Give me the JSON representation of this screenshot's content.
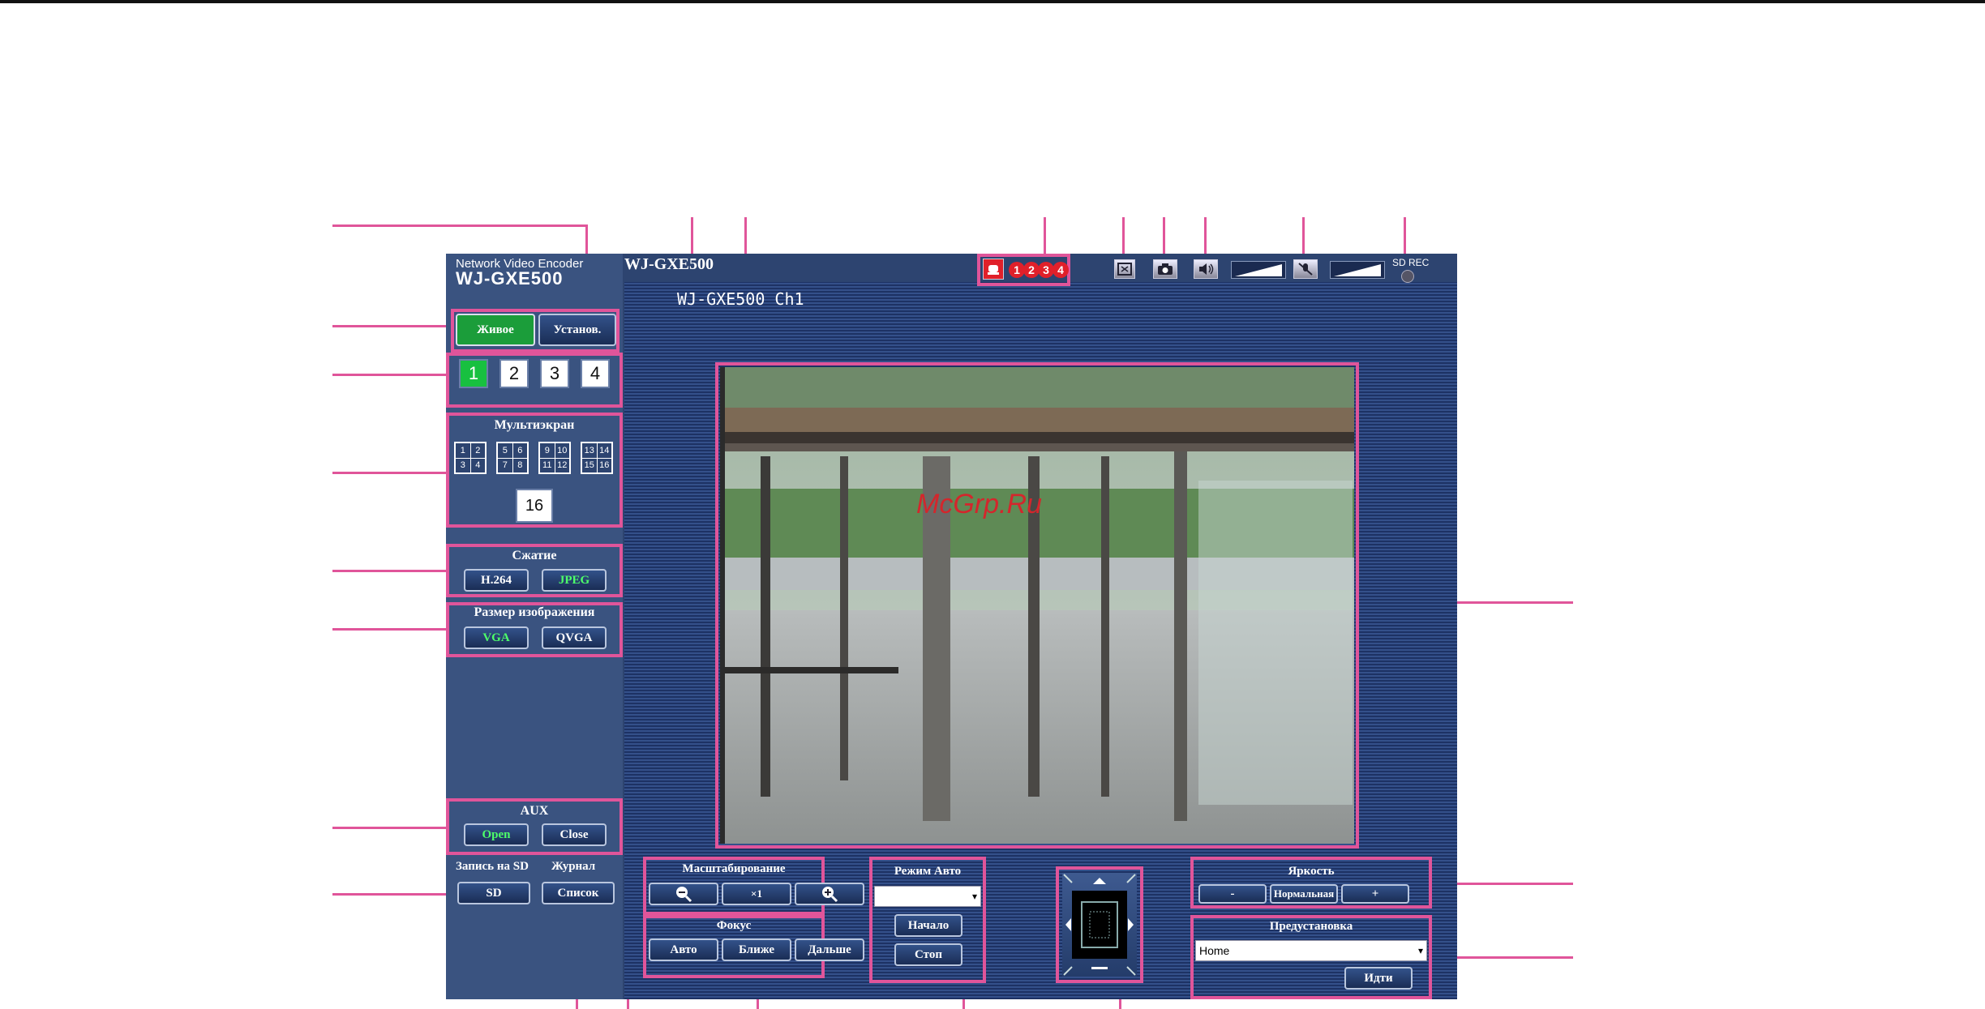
{
  "brand": {
    "line1": "Network Video Encoder",
    "line2": "WJ-GXE500"
  },
  "header": {
    "camera_title": "WJ-GXE500",
    "osd_text": "WJ-GXE500 Ch1",
    "sd_rec_label": "SD REC"
  },
  "tabs": {
    "live": "Живое",
    "setup": "Установ."
  },
  "channels": [
    "1",
    "2",
    "3",
    "4"
  ],
  "multiscreen": {
    "title": "Мультиэкран",
    "groups": [
      [
        "1",
        "2",
        "3",
        "4"
      ],
      [
        "5",
        "6",
        "7",
        "8"
      ],
      [
        "9",
        "10",
        "11",
        "12"
      ],
      [
        "13",
        "14",
        "15",
        "16"
      ]
    ],
    "sixteen": "16"
  },
  "compression": {
    "title": "Сжатие",
    "h264": "H.264",
    "jpeg": "JPEG"
  },
  "image_size": {
    "title": "Размер изображения",
    "vga": "VGA",
    "qvga": "QVGA"
  },
  "aux": {
    "title": "AUX",
    "open": "Open",
    "close": "Close"
  },
  "sd": {
    "title": "Запись на SD",
    "button": "SD"
  },
  "log": {
    "title": "Журнал",
    "button": "Список"
  },
  "alarms": [
    "1",
    "2",
    "3",
    "4"
  ],
  "zoom": {
    "title": "Масштабирование",
    "reset": "×1"
  },
  "focus": {
    "title": "Фокус",
    "auto": "Авто",
    "near": "Ближе",
    "far": "Дальше"
  },
  "auto_mode": {
    "title": "Режим Авто",
    "start": "Начало",
    "stop": "Стоп"
  },
  "brightness": {
    "title": "Яркость",
    "minus": "-",
    "normal": "Нормальная",
    "plus": "+"
  },
  "preset": {
    "title": "Предустановка",
    "value": "Home",
    "go": "Идти"
  },
  "watermark": "McGrp.Ru",
  "colors": {
    "annotation": "#e0559a",
    "panel": "#2d4470",
    "active_green": "#18c040"
  }
}
